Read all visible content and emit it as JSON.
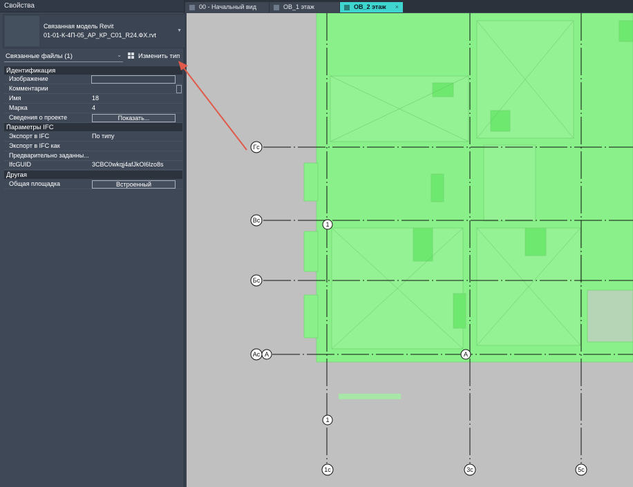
{
  "properties": {
    "title": "Свойства",
    "type_line1": "Связанная модель Revit",
    "type_line2": "01-01-К-4П-05_АР_КР_С01_R24.ФХ.rvt",
    "filter": "Связанные файлы (1)",
    "edit_type": "Изменить тип",
    "groups": {
      "identity": "Идентификация",
      "ifc": "Параметры IFC",
      "other": "Другая"
    },
    "rows": {
      "image": {
        "k": "Изображение",
        "v": ""
      },
      "comments": {
        "k": "Комментарии",
        "v": ""
      },
      "name": {
        "k": "Имя",
        "v": "18"
      },
      "mark": {
        "k": "Марка",
        "v": "4"
      },
      "project_info": {
        "k": "Сведения о проекте",
        "v": "Показать..."
      },
      "export_ifc": {
        "k": "Экспорт в IFC",
        "v": "По типу"
      },
      "export_ifc_as": {
        "k": "Экспорт в IFC как",
        "v": ""
      },
      "predefined": {
        "k": "Предварительно заданны...",
        "v": ""
      },
      "ifcguid": {
        "k": "IfcGUID",
        "v": "3CBC0wkqj4afJkOl6lzo8s"
      },
      "shared_site": {
        "k": "Общая площадка",
        "v": "Встроенный"
      }
    }
  },
  "tabs": [
    {
      "label": "00 - Начальный вид",
      "active": false
    },
    {
      "label": "ОВ_1 этаж",
      "active": false
    },
    {
      "label": "ОВ_2 этаж",
      "active": true
    }
  ],
  "grid_labels": {
    "gc": "Гс",
    "vc": "Вс",
    "bc": "Бс",
    "ac": "Ас",
    "a": "А",
    "a2": "А",
    "one_top": "1",
    "one_mid": "1",
    "c1": "1с",
    "c3": "3с",
    "c5": "5с"
  },
  "colors": {
    "accent_tab": "#3ed6cf",
    "model_fill": "#8af08a",
    "annotation_arrow": "#e05a4a"
  }
}
